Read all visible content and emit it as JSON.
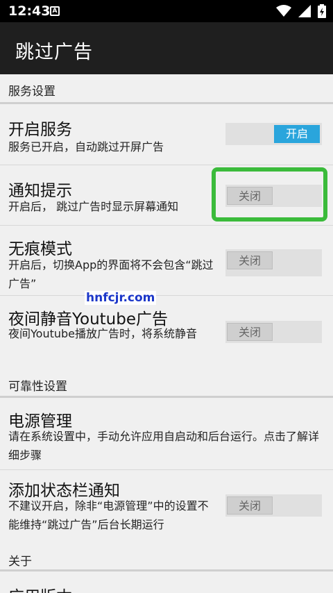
{
  "status_bar": {
    "time": "12:43",
    "a_icon": "A"
  },
  "app_bar": {
    "title": "跳过广告"
  },
  "sections": {
    "service": "服务设置",
    "reliability": "可靠性设置",
    "about": "关于"
  },
  "rows": {
    "start_service": {
      "title": "开启服务",
      "subtitle": "服务已开启，自动跳过开屏广告",
      "toggle": "开启"
    },
    "notify": {
      "title": "通知提示",
      "subtitle": "开启后， 跳过广告时显示屏幕通知",
      "toggle": "关闭"
    },
    "incognito": {
      "title": "无痕模式",
      "subtitle": "开启后，切换App的界面将不会包含“跳过广告”",
      "toggle": "关闭"
    },
    "night_mute": {
      "title": "夜间静音Youtube广告",
      "subtitle": "夜间Youtube播放广告时，将系统静音",
      "toggle": "关闭"
    },
    "power": {
      "title": "电源管理",
      "subtitle": "请在系统设置中，手动允许应用自启动和后台运行。点击了解详细步骤"
    },
    "status_notify": {
      "title": "添加状态栏通知",
      "subtitle": "不建议开启，除非“电源管理”中的设置不能维持“跳过广告”后台长期运行",
      "toggle": "关闭"
    },
    "version": {
      "title": "应用版本"
    }
  },
  "watermark": "hnfcjr.com",
  "colors": {
    "toggle_on": "#2aa5dc",
    "highlight": "#3bbb3b",
    "app_bar": "#1f1f1f"
  }
}
